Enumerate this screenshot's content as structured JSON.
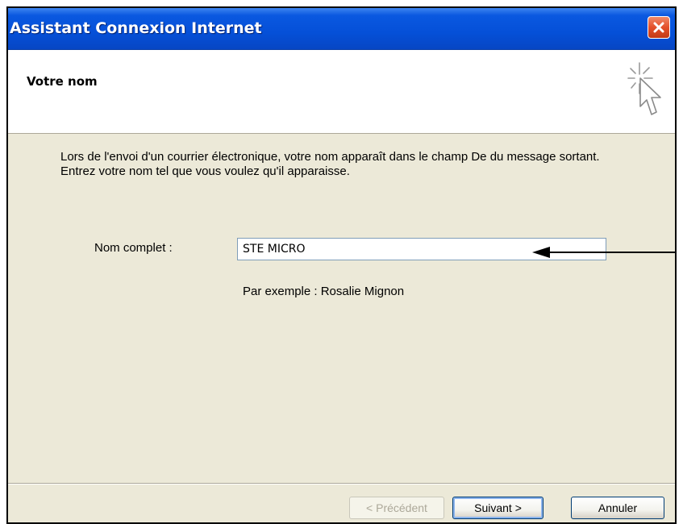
{
  "window": {
    "title": "Assistant Connexion Internet",
    "close_icon": "close-icon",
    "titlebar_color": "#0550d8",
    "close_color": "#e4502a"
  },
  "header": {
    "title": "Votre nom",
    "icon": "cursor-sparkle-icon"
  },
  "content": {
    "description": "Lors de l'envoi d'un courrier électronique, votre nom apparaît dans le champ De du message sortant. Entrez votre nom tel que vous voulez qu'il apparaisse.",
    "name_label": "Nom complet :",
    "name_value": "STE MICRO",
    "example": "Par exemple : Rosalie Mignon"
  },
  "buttons": {
    "previous": "< Précédent",
    "next": "Suivant >",
    "cancel": "Annuler"
  }
}
